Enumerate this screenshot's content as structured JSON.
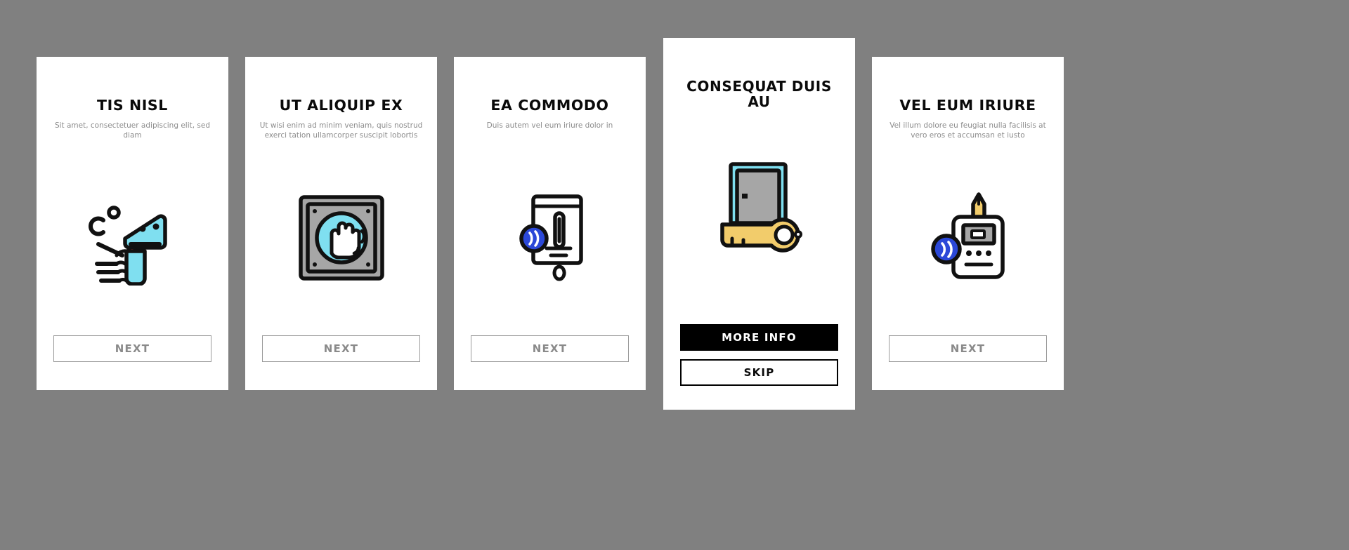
{
  "page": {
    "background_color": "#808080",
    "card_background": "#ffffff"
  },
  "palette": {
    "stroke": "#111111",
    "cyan": "#7fdff0",
    "blue": "#2b48d8",
    "gray_fill": "#a6a6a6",
    "yellow": "#f2cc6b",
    "red": "#e03a2f",
    "muted_text": "#8c8c8c",
    "title_text": "#0a0a0a",
    "button_outline": "#9a9a9a",
    "button_text": "#8a8a8a",
    "primary_button_bg": "#000000",
    "primary_button_text": "#ffffff"
  },
  "screens": [
    {
      "id": "screen-1",
      "title": "TIS NISL",
      "subtitle": "Sit amet, consectetuer adipiscing elit, sed diam",
      "icon_name": "infrared-thermometer-gun-icon",
      "highlighted": false,
      "buttons": [
        {
          "label": "NEXT",
          "style": "outline",
          "name": "next-button"
        }
      ]
    },
    {
      "id": "screen-2",
      "title": "UT ALIQUIP EX",
      "subtitle": "Ut wisi enim ad minim veniam, quis nostrud exerci tation ullamcorper suscipit lobortis",
      "icon_name": "hand-scanner-panel-icon",
      "highlighted": false,
      "buttons": [
        {
          "label": "NEXT",
          "style": "outline",
          "name": "next-button"
        }
      ]
    },
    {
      "id": "screen-3",
      "title": "EA COMMODO",
      "subtitle": "Duis autem vel eum iriure dolor in",
      "icon_name": "contactless-sanitizer-dispenser-icon",
      "highlighted": false,
      "buttons": [
        {
          "label": "NEXT",
          "style": "outline",
          "name": "next-button"
        }
      ]
    },
    {
      "id": "screen-4",
      "title": "CONSEQUAT DUIS AU",
      "subtitle": "",
      "icon_name": "door-with-key-icon",
      "highlighted": true,
      "buttons": [
        {
          "label": "MORE INFO",
          "style": "primary",
          "name": "more-info-button"
        },
        {
          "label": "SKIP",
          "style": "secondary",
          "name": "skip-button"
        }
      ]
    },
    {
      "id": "screen-5",
      "title": "VEL EUM IRIURE",
      "subtitle": "Vel illum dolore eu feugiat nulla facilisis at vero eros et accumsan et iusto",
      "icon_name": "contactless-glucose-meter-icon",
      "highlighted": false,
      "buttons": [
        {
          "label": "NEXT",
          "style": "outline",
          "name": "next-button"
        }
      ]
    }
  ]
}
